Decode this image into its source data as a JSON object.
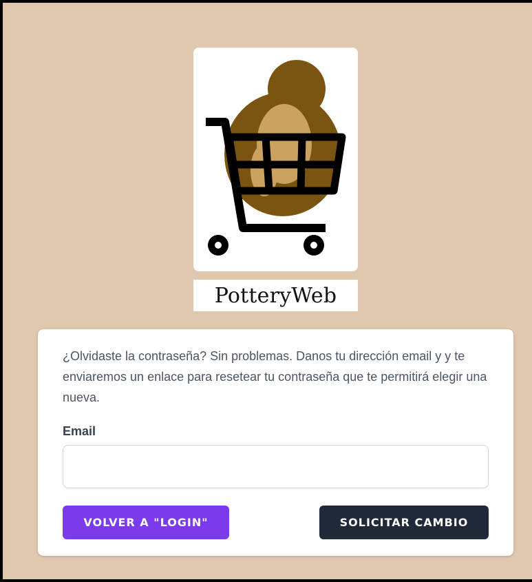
{
  "brand": {
    "name": "PotteryWeb",
    "logo_icon": "shopping-cart-with-pottery-logo"
  },
  "colors": {
    "page_background": "#dfc8ad",
    "back_button": "#7c3aed",
    "submit_button": "#1f2937",
    "logo_dark": "#7a5510",
    "logo_light": "#c9a35f"
  },
  "form": {
    "description": "¿Olvidaste la contraseña? Sin problemas. Danos tu dirección email y y te enviaremos un enlace para resetear tu contraseña que te permitirá elegir una nueva.",
    "email_label": "Email",
    "email_value": "",
    "back_button_label": "VOLVER A \"LOGIN\"",
    "submit_button_label": "SOLICITAR CAMBIO"
  }
}
